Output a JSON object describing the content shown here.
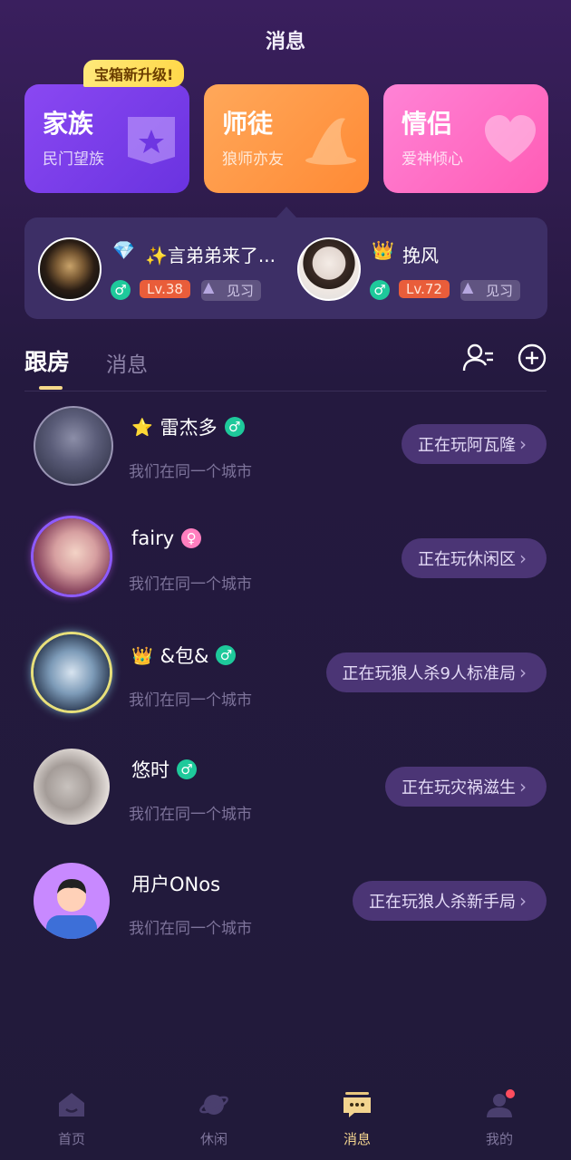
{
  "header": {
    "title": "消息"
  },
  "promo_tag": "宝箱新升级!",
  "cards": [
    {
      "title": "家族",
      "subtitle": "民门望族",
      "color": "#7a3df0"
    },
    {
      "title": "师徒",
      "subtitle": "狼师亦友",
      "color": "#ff9a47"
    },
    {
      "title": "情侣",
      "subtitle": "爱神倾心",
      "color": "#ff6ec4"
    }
  ],
  "rooms": [
    {
      "name": "✨言弟弟来了...",
      "level": "Lv.38",
      "stage": "见习"
    },
    {
      "name": "挽风",
      "level": "Lv.72",
      "stage": "见习"
    }
  ],
  "tabs": {
    "active": "跟房",
    "other": "消息"
  },
  "follow_list": [
    {
      "name": "雷杰多",
      "sub": "我们在同一个城市",
      "status": "正在玩阿瓦隆"
    },
    {
      "name": "fairy",
      "sub": "我们在同一个城市",
      "status": "正在玩休闲区"
    },
    {
      "name": "&包&",
      "sub": "我们在同一个城市",
      "status": "正在玩狼人杀9人标准局"
    },
    {
      "name": "悠时",
      "sub": "我们在同一个城市",
      "status": "正在玩灾祸滋生"
    },
    {
      "name": "用户ONos",
      "sub": "我们在同一个城市",
      "status": "正在玩狼人杀新手局"
    }
  ],
  "bottom_nav": [
    {
      "label": "首页",
      "icon": "home-icon"
    },
    {
      "label": "休闲",
      "icon": "planet-icon"
    },
    {
      "label": "消息",
      "icon": "message-icon",
      "active": true
    },
    {
      "label": "我的",
      "icon": "profile-icon"
    }
  ],
  "colors": {
    "accent": "#f6d98a",
    "background": "#211a3a",
    "gender_male": "#1ec99b",
    "level": "#e95d3a"
  }
}
